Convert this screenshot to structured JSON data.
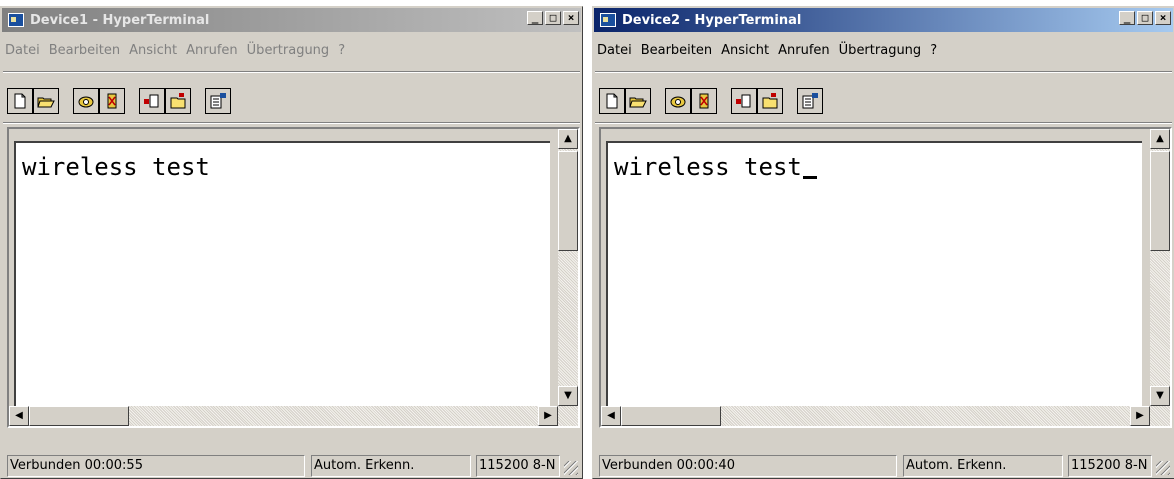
{
  "windows": [
    {
      "title": "Device1 - HyperTerminal",
      "state": "inactive",
      "menu": [
        "Datei",
        "Bearbeiten",
        "Ansicht",
        "Anrufen",
        "Übertragung",
        "?"
      ],
      "terminal_text": "wireless test",
      "cursor_visible": false,
      "status": {
        "connection": "Verbunden 00:00:55",
        "detect": "Autom. Erkenn.",
        "port": "115200 8-N"
      }
    },
    {
      "title": "Device2 - HyperTerminal",
      "state": "active",
      "menu": [
        "Datei",
        "Bearbeiten",
        "Ansicht",
        "Anrufen",
        "Übertragung",
        "?"
      ],
      "terminal_text": "wireless test",
      "cursor_visible": true,
      "status": {
        "connection": "Verbunden 00:00:40",
        "detect": "Autom. Erkenn.",
        "port": "115200 8-N"
      }
    }
  ],
  "caption_buttons": {
    "minimize": "_",
    "maximize": "□",
    "close": "×"
  },
  "toolbar_icons": [
    "new-document-icon",
    "open-folder-icon",
    "call-phone-icon",
    "disconnect-phone-icon",
    "send-file-icon",
    "receive-file-icon",
    "properties-icon"
  ],
  "scroll_glyphs": {
    "up": "▲",
    "down": "▼",
    "left": "◀",
    "right": "▶"
  },
  "colors": {
    "title_active": "#0a246a",
    "title_inactive": "#808080",
    "chrome": "#d4d0c8"
  }
}
